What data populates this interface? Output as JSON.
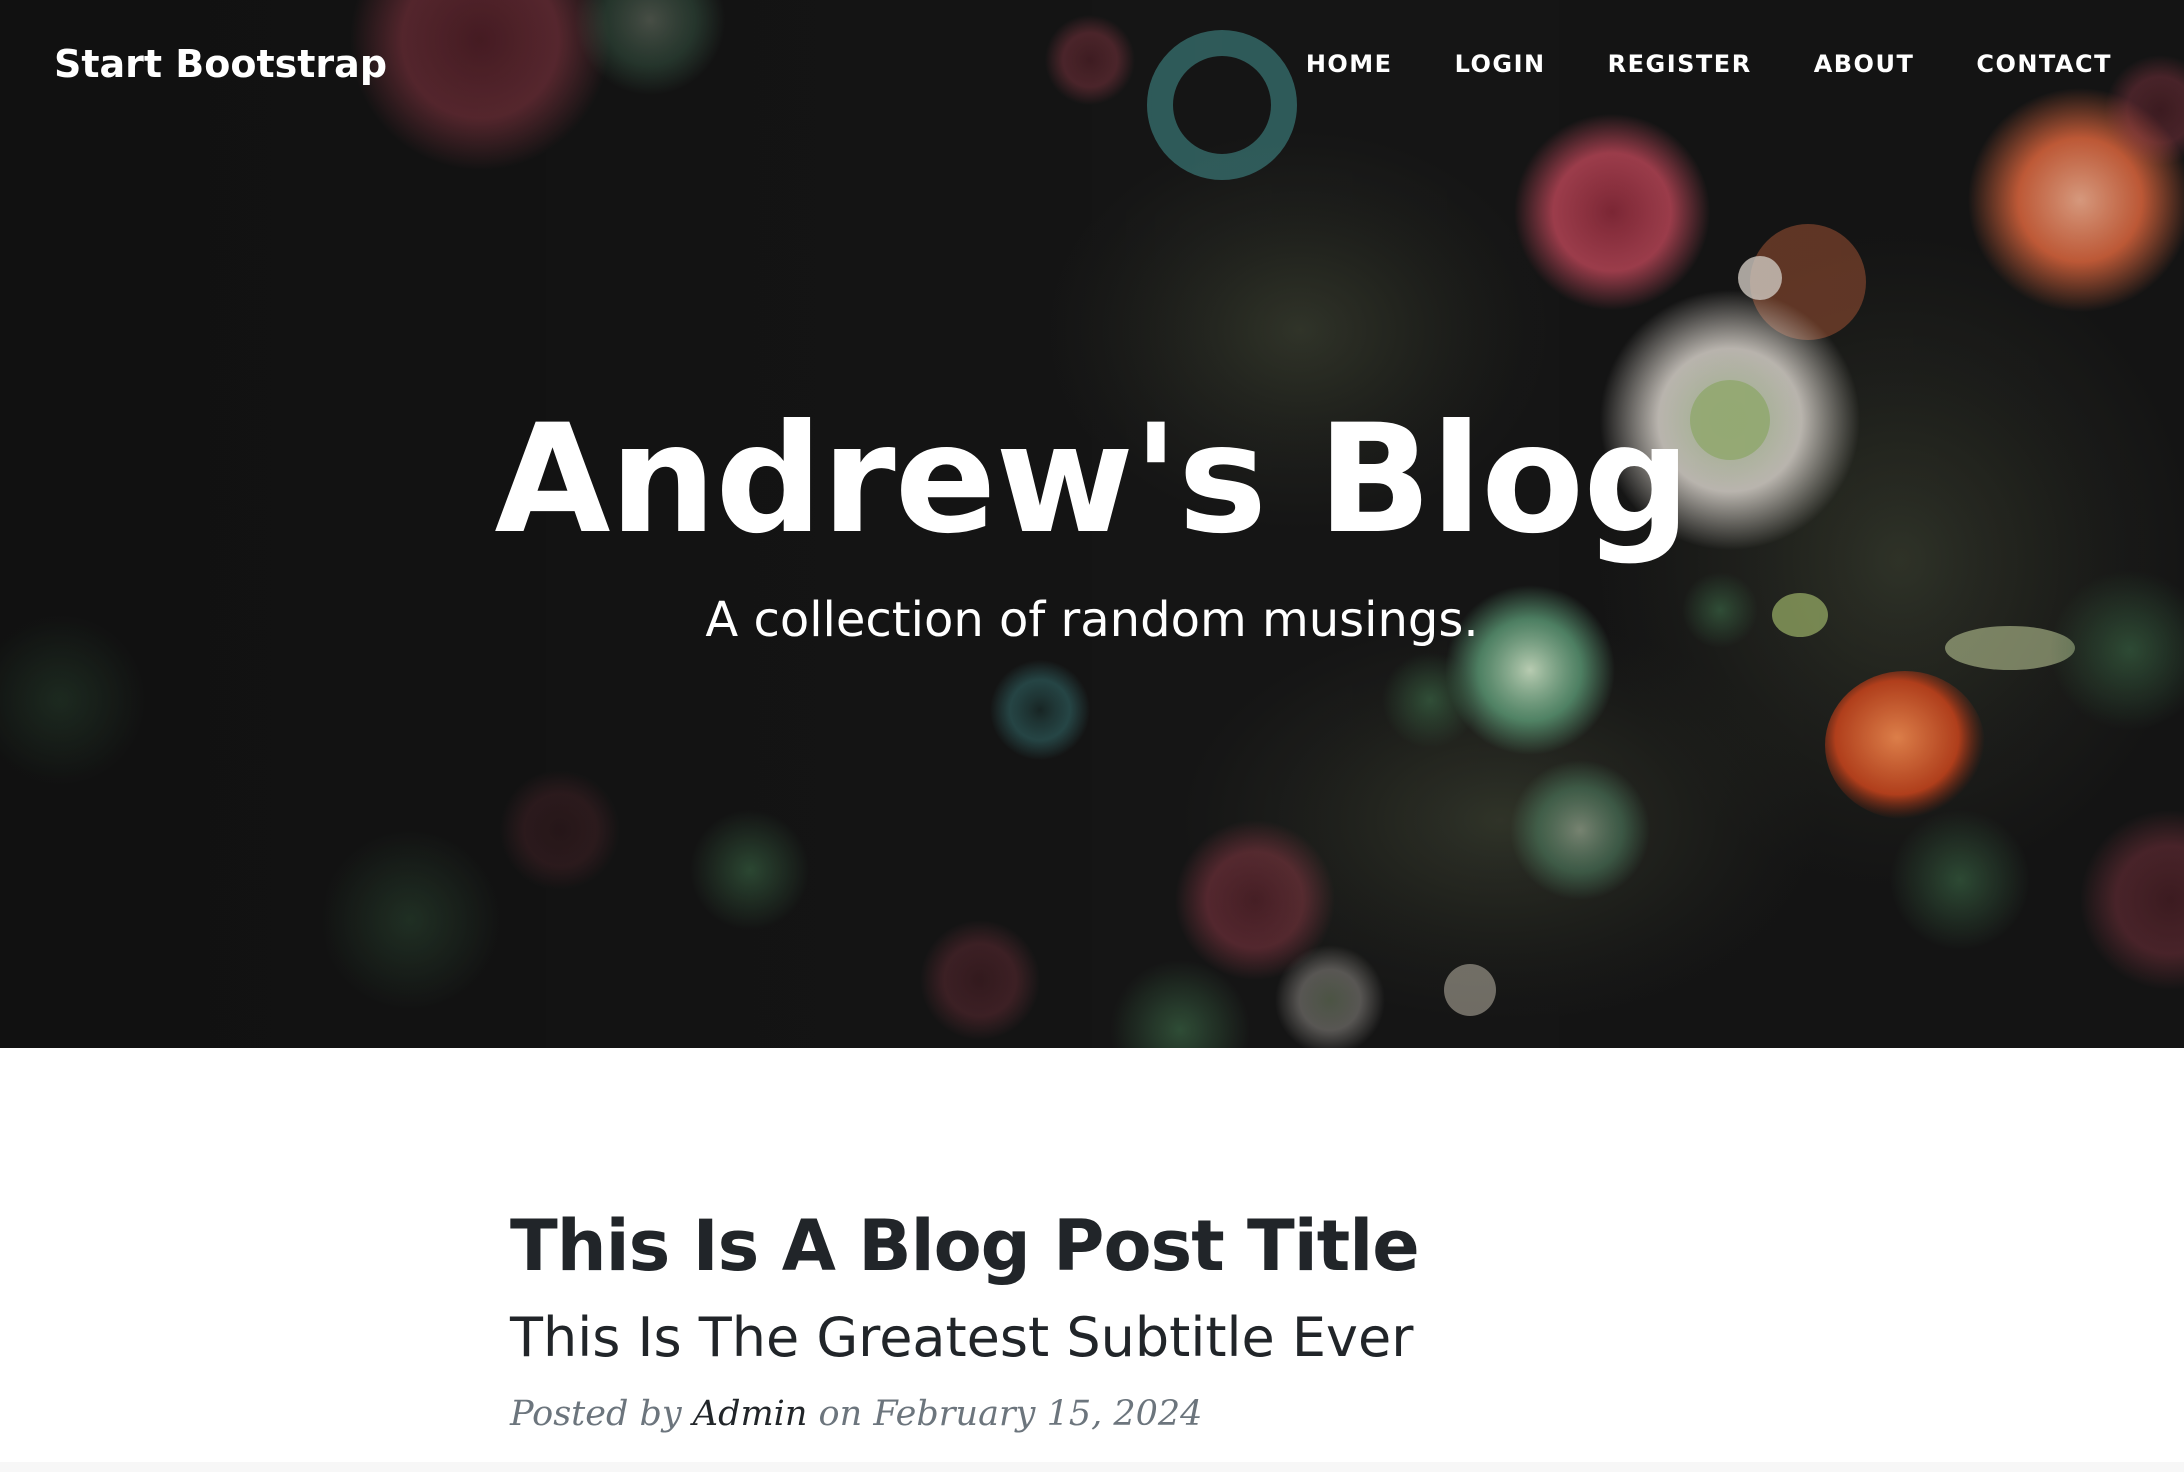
{
  "navbar": {
    "brand": "Start Bootstrap",
    "links": [
      "HOME",
      "LOGIN",
      "REGISTER",
      "ABOUT",
      "CONTACT"
    ]
  },
  "hero": {
    "title": "Andrew's Blog",
    "subtitle": "A collection of random musings."
  },
  "post": {
    "title": "This Is A Blog Post Title",
    "subtitle": "This Is The Greatest Subtitle Ever",
    "meta_prefix": "Posted by",
    "author": "Admin",
    "meta_on": "on",
    "date": "February 15, 2024"
  },
  "colors": {
    "hero_bg": "#151515",
    "text_light": "#ffffff",
    "text_dark": "#212529",
    "text_muted": "#6c757d"
  }
}
